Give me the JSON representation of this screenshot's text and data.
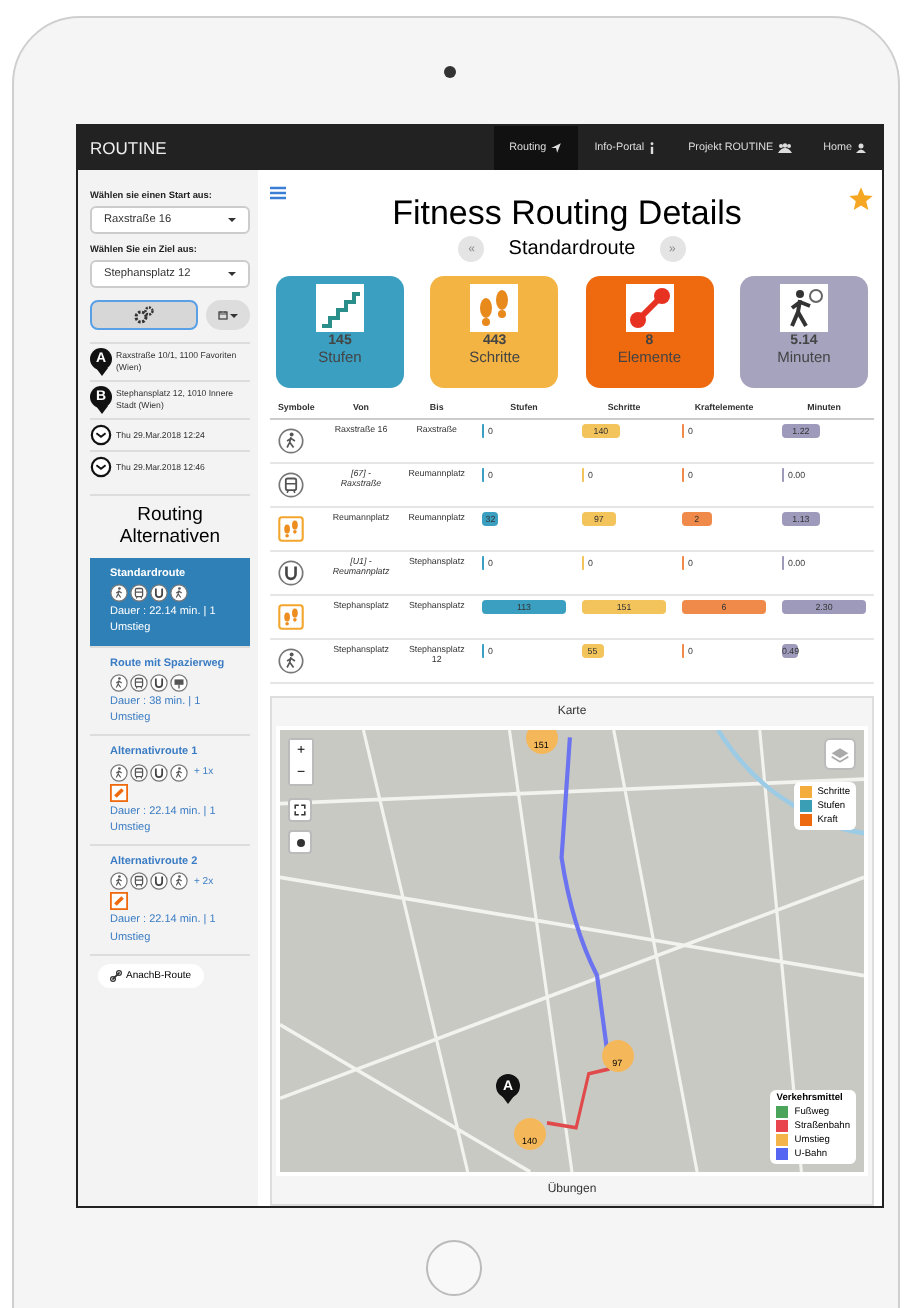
{
  "navbar": {
    "brand": "ROUTINE",
    "items": [
      {
        "label": "Routing",
        "kind": "send",
        "selected": true
      },
      {
        "label": "Info-Portal",
        "kind": "info",
        "selected": false
      },
      {
        "label": "Projekt ROUTINE",
        "kind": "group",
        "selected": false
      },
      {
        "label": "Home",
        "kind": "user",
        "selected": false
      }
    ]
  },
  "sidebar": {
    "start_label": "Wählen sie einen Start aus:",
    "start_value": "Raxstraße 16",
    "goal_label": "Wählen Sie ein Ziel aus:",
    "goal_value": "Stephansplatz 12",
    "trip": [
      {
        "kind": "marker",
        "letter": "A",
        "text": "Raxstraße 10/1, 1100 Favoriten (Wien)"
      },
      {
        "kind": "marker",
        "letter": "B",
        "text": "Stephansplatz 12, 1010 Innere Stadt (Wien)"
      },
      {
        "kind": "clock",
        "text": "Thu 29.Mar.2018 12:24"
      },
      {
        "kind": "clock",
        "text": "Thu 29.Mar.2018 12:46"
      }
    ],
    "alternatives_title": "Routing Alternativen",
    "alternatives": [
      {
        "title": "Standardroute",
        "modes": [
          {
            "kind": "walk"
          },
          {
            "kind": "tram"
          },
          {
            "kind": "ubahn"
          },
          {
            "kind": "walk"
          }
        ],
        "duration": "Dauer : 22.14 min. | 1 Umstieg",
        "selected": true
      },
      {
        "title": "Route mit Spazierweg",
        "modes": [
          {
            "kind": "walk"
          },
          {
            "kind": "tram"
          },
          {
            "kind": "ubahn"
          },
          {
            "kind": "other"
          }
        ],
        "duration": "Dauer : 38 min. | 1 Umstieg",
        "selected": false
      },
      {
        "title": "Alternativroute 1",
        "modes": [
          {
            "kind": "walk"
          },
          {
            "kind": "tram"
          },
          {
            "kind": "ubahn"
          },
          {
            "kind": "walk"
          }
        ],
        "extra": "+ 1x",
        "exercise": true,
        "duration": "Dauer : 22.14 min. | 1 Umstieg",
        "selected": false
      },
      {
        "title": "Alternativroute 2",
        "modes": [
          {
            "kind": "walk"
          },
          {
            "kind": "tram"
          },
          {
            "kind": "ubahn"
          },
          {
            "kind": "walk"
          }
        ],
        "extra": "+ 2x",
        "exercise": true,
        "duration": "Dauer : 22.14 min. | 1 Umstieg",
        "selected": false
      }
    ],
    "anachb_button": "AnachB-Route"
  },
  "main": {
    "title": "Fitness Routing Details",
    "subtitle": "Standardroute",
    "prev": "«",
    "next": "»",
    "stats": [
      {
        "kind": "stairs",
        "value": "145",
        "label": "Stufen",
        "color": "#3a9fc0"
      },
      {
        "kind": "steps",
        "value": "443",
        "label": "Schritte",
        "color": "#f3b443"
      },
      {
        "kind": "dumbbell",
        "value": "8",
        "label": "Elemente",
        "color": "#ef6a0f"
      },
      {
        "kind": "walker",
        "value": "5.14",
        "label": "Minuten",
        "color": "#a6a3bf"
      }
    ],
    "table": {
      "columns": [
        "Symbole",
        "Von",
        "Bis",
        "Stufen",
        "Schritte",
        "Kraftelemente",
        "Minuten"
      ],
      "rows": [
        {
          "cells": [
            {
              "kind": "walk"
            },
            {
              "text": "Raxstraße 16"
            },
            {
              "text": "Raxstraße"
            },
            {
              "text": "0",
              "level": 0
            },
            {
              "text": "140",
              "level": 0.45
            },
            {
              "text": "0",
              "level": 0
            },
            {
              "text": "1.22",
              "level": 0.45
            }
          ]
        },
        {
          "cells": [
            {
              "kind": "tram"
            },
            {
              "text": "[67] - Raxstraße",
              "italic": true
            },
            {
              "text": "Reumannplatz"
            },
            {
              "text": "0",
              "level": 0
            },
            {
              "text": "0",
              "level": 0
            },
            {
              "text": "0",
              "level": 0
            },
            {
              "text": "0.00",
              "level": 0
            }
          ]
        },
        {
          "cells": [
            {
              "kind": "steps"
            },
            {
              "text": "Reumannplatz"
            },
            {
              "text": "Reumannplatz"
            },
            {
              "text": "32",
              "level": 0.2
            },
            {
              "text": "97",
              "level": 0.4
            },
            {
              "text": "2",
              "level": 0.35
            },
            {
              "text": "1.13",
              "level": 0.45
            }
          ]
        },
        {
          "cells": [
            {
              "kind": "ubahn"
            },
            {
              "text": "[U1] - Reumannplatz",
              "italic": true
            },
            {
              "text": "Stephansplatz"
            },
            {
              "text": "0",
              "level": 0
            },
            {
              "text": "0",
              "level": 0
            },
            {
              "text": "0",
              "level": 0
            },
            {
              "text": "0.00",
              "level": 0
            }
          ]
        },
        {
          "cells": [
            {
              "kind": "steps"
            },
            {
              "text": "Stephansplatz"
            },
            {
              "text": "Stephansplatz"
            },
            {
              "text": "113",
              "level": 1
            },
            {
              "text": "151",
              "level": 1
            },
            {
              "text": "6",
              "level": 1
            },
            {
              "text": "2.30",
              "level": 1
            }
          ]
        },
        {
          "cells": [
            {
              "kind": "walk"
            },
            {
              "text": "Stephansplatz"
            },
            {
              "text": "Stephansplatz 12"
            },
            {
              "text": "0",
              "level": 0
            },
            {
              "text": "55",
              "level": 0.25
            },
            {
              "text": "0",
              "level": 0
            },
            {
              "text": "0.49",
              "level": 0.2
            }
          ]
        }
      ]
    },
    "map_panel": {
      "header": "Karte",
      "zoom_in": "+",
      "zoom_out": "−",
      "clusters": [
        "151",
        "97",
        "140"
      ],
      "marker": "A",
      "legend": [
        {
          "label": "Schritte",
          "color": "#f4ad3d"
        },
        {
          "label": "Stufen",
          "color": "#3a9fb5"
        },
        {
          "label": "Kraft",
          "color": "#ee6a10"
        }
      ],
      "transport_title": "Verkehrsmittel",
      "transport": [
        {
          "label": "Fußweg",
          "color": "#4aa55a"
        },
        {
          "label": "Straßenbahn",
          "color": "#e8454f"
        },
        {
          "label": "Umstieg",
          "color": "#f4b44a"
        },
        {
          "label": "U-Bahn",
          "color": "#5766f2"
        }
      ]
    },
    "exercises_header": "Übungen"
  }
}
